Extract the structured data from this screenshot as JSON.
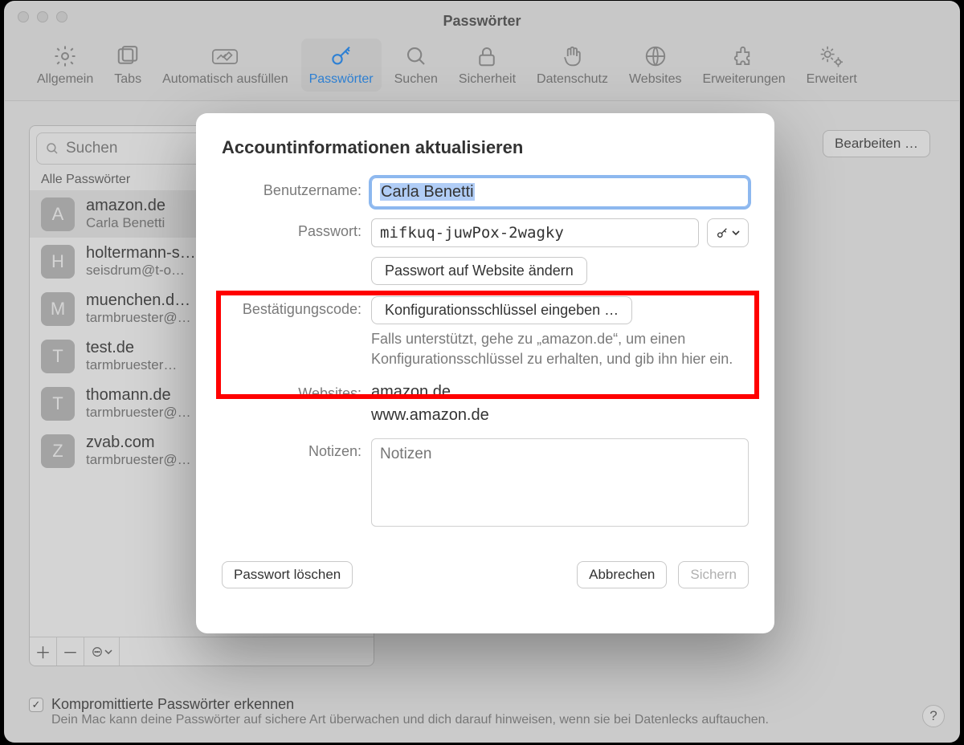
{
  "window": {
    "title": "Passwörter"
  },
  "toolbar": {
    "items": [
      {
        "label": "Allgemein"
      },
      {
        "label": "Tabs"
      },
      {
        "label": "Automatisch ausfüllen"
      },
      {
        "label": "Passwörter"
      },
      {
        "label": "Suchen"
      },
      {
        "label": "Sicherheit"
      },
      {
        "label": "Datenschutz"
      },
      {
        "label": "Websites"
      },
      {
        "label": "Erweiterungen"
      },
      {
        "label": "Erweitert"
      }
    ]
  },
  "search": {
    "placeholder": "Suchen"
  },
  "list": {
    "header": "Alle Passwörter",
    "rows": [
      {
        "initial": "A",
        "site": "amazon.de",
        "user": "Carla Benetti"
      },
      {
        "initial": "H",
        "site": "holtermann-s…",
        "user": "seisdrum@t-o…"
      },
      {
        "initial": "M",
        "site": "muenchen.d…",
        "user": "tarmbruester@…"
      },
      {
        "initial": "T",
        "site": "test.de",
        "user": "tarmbruester…"
      },
      {
        "initial": "T",
        "site": "thomann.de",
        "user": "tarmbruester@…"
      },
      {
        "initial": "Z",
        "site": "zvab.com",
        "user": "tarmbruester@…"
      }
    ]
  },
  "edit_button": "Bearbeiten …",
  "check": {
    "title": "Kompromittierte Passwörter erkennen",
    "desc": "Dein Mac kann deine Passwörter auf sichere Art überwachen und dich darauf hinweisen, wenn sie bei Datenlecks auftauchen."
  },
  "modal": {
    "title": "Accountinformationen aktualisieren",
    "username_label": "Benutzername:",
    "username_value": "Carla Benetti",
    "password_label": "Passwort:",
    "password_value": "mifkuq-juwPox-2wagky",
    "change_on_site": "Passwort auf Website ändern",
    "code_label": "Bestätigungscode:",
    "code_button": "Konfigurationsschlüssel eingeben …",
    "code_hint": "Falls unterstützt, gehe zu „amazon.de“, um einen Konfigurationsschlüssel zu erhalten, und gib ihn hier ein.",
    "websites_label": "Websites:",
    "websites": [
      "amazon.de",
      "www.amazon.de"
    ],
    "notes_label": "Notizen:",
    "notes_placeholder": "Notizen",
    "delete": "Passwort löschen",
    "cancel": "Abbrechen",
    "save": "Sichern"
  }
}
